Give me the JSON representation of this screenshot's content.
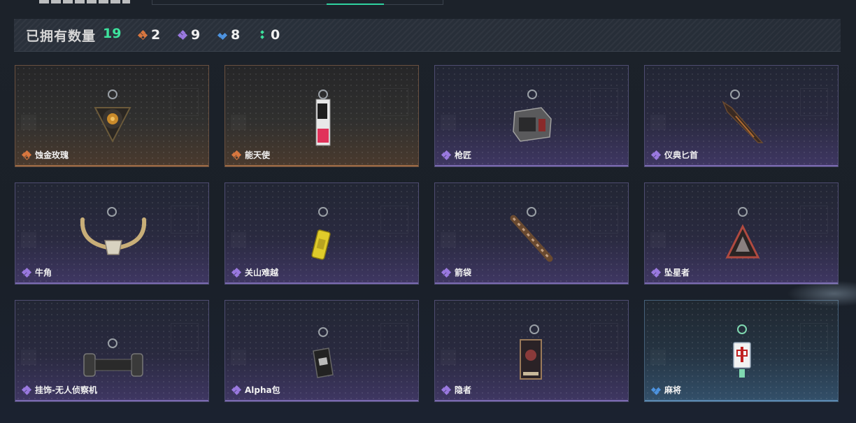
{
  "summary": {
    "label": "已拥有数量",
    "total": "19",
    "counts": [
      {
        "rarity": "orange",
        "color": "#d9773f",
        "value": "2"
      },
      {
        "rarity": "purple",
        "color": "#9a79e0",
        "value": "9"
      },
      {
        "rarity": "blue",
        "color": "#4d93e0",
        "value": "8"
      },
      {
        "rarity": "green",
        "color": "#3de39d",
        "value": "0"
      }
    ]
  },
  "items": [
    {
      "name": "蚀金玫瑰",
      "rarity": "orange",
      "icon": "golden-rose-pendant-icon"
    },
    {
      "name": "能天使",
      "rarity": "orange",
      "icon": "card-charm-icon"
    },
    {
      "name": "枪匠",
      "rarity": "purple",
      "icon": "gun-case-charm-icon"
    },
    {
      "name": "仪典匕首",
      "rarity": "purple",
      "icon": "dagger-charm-icon"
    },
    {
      "name": "牛角",
      "rarity": "purple",
      "icon": "bull-horn-charm-icon"
    },
    {
      "name": "关山难越",
      "rarity": "purple",
      "icon": "yellow-can-charm-icon"
    },
    {
      "name": "箭袋",
      "rarity": "purple",
      "icon": "quiver-charm-icon"
    },
    {
      "name": "坠星者",
      "rarity": "purple",
      "icon": "triangle-badge-charm-icon"
    },
    {
      "name": "挂饰-无人侦察机",
      "rarity": "purple",
      "icon": "drone-charm-icon"
    },
    {
      "name": "Alpha包",
      "rarity": "purple",
      "icon": "pouch-charm-icon"
    },
    {
      "name": "隐者",
      "rarity": "purple",
      "icon": "tarot-card-charm-icon"
    },
    {
      "name": "麻将",
      "rarity": "blue",
      "icon": "mahjong-tile-charm-icon"
    }
  ]
}
